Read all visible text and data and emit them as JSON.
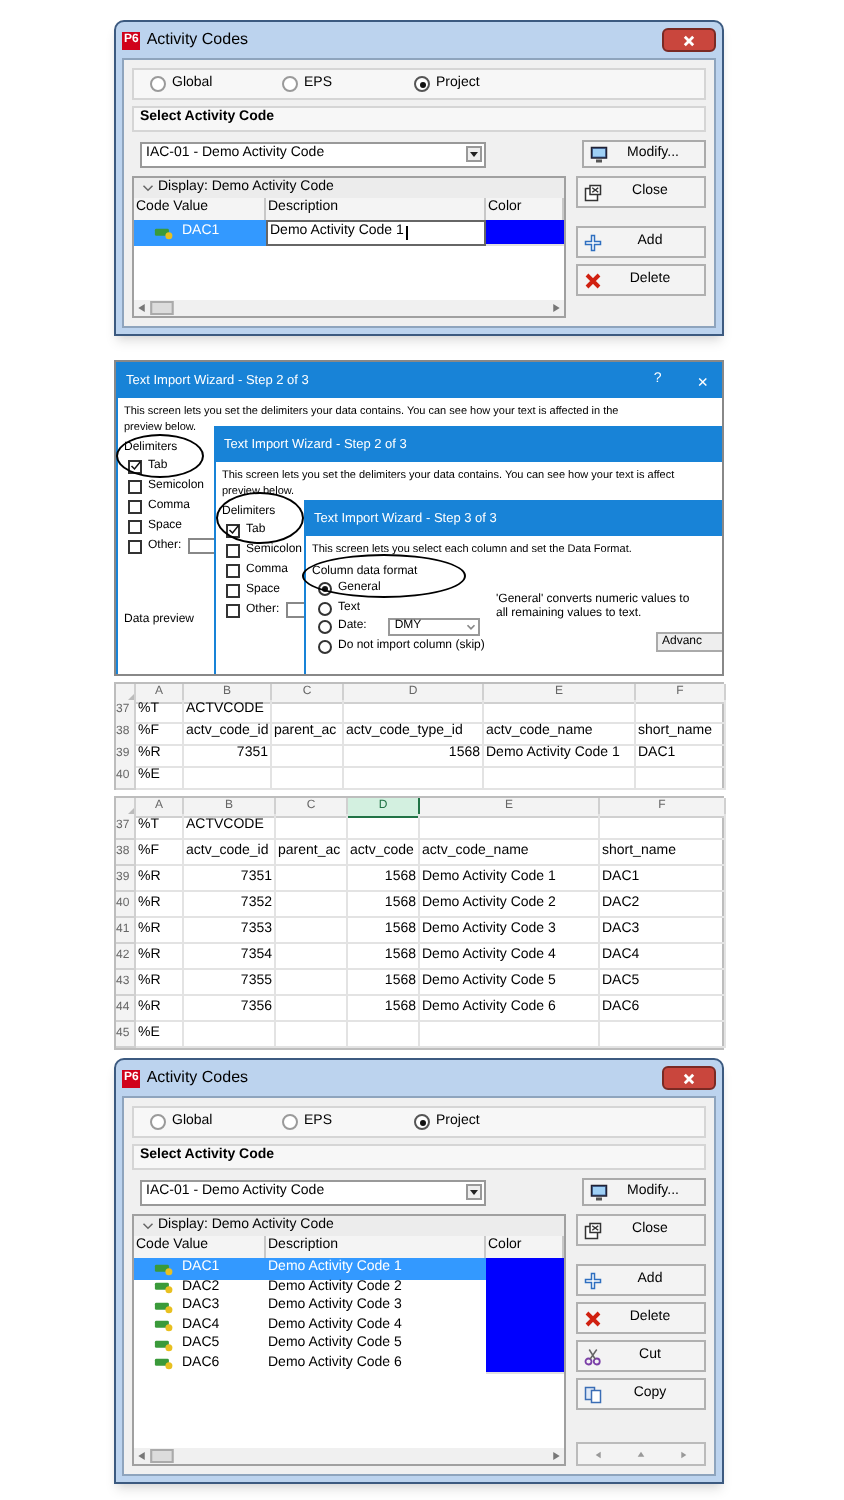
{
  "dialogs": [
    {
      "badge": "P6",
      "title": "Activity Codes",
      "scopes": [
        {
          "label": "Global",
          "selected": false
        },
        {
          "label": "EPS",
          "selected": false
        },
        {
          "label": "Project",
          "selected": true
        }
      ],
      "section": "Select Activity Code",
      "activity_code": "IAC-01 - Demo Activity Code",
      "modify": "Modify...",
      "display": "Display: Demo Activity Code",
      "columns": [
        "Code Value",
        "Description",
        "Color"
      ],
      "rows": [
        {
          "code": "DAC1",
          "description": "Demo Activity Code 1",
          "color": "#0000ff",
          "selected": true,
          "editing": true
        }
      ],
      "buttons": [
        {
          "kind": "close",
          "label": "Close"
        },
        {
          "kind": "add",
          "label": "Add"
        },
        {
          "kind": "delete",
          "label": "Delete"
        }
      ]
    },
    {
      "badge": "P6",
      "title": "Activity Codes",
      "scopes": [
        {
          "label": "Global",
          "selected": false
        },
        {
          "label": "EPS",
          "selected": false
        },
        {
          "label": "Project",
          "selected": true
        }
      ],
      "section": "Select Activity Code",
      "activity_code": "IAC-01 - Demo Activity Code",
      "modify": "Modify...",
      "display": "Display: Demo Activity Code",
      "columns": [
        "Code Value",
        "Description",
        "Color"
      ],
      "rows": [
        {
          "code": "DAC1",
          "description": "Demo Activity Code 1",
          "color": "#0000ff",
          "selected": true,
          "editing": false
        },
        {
          "code": "DAC2",
          "description": "Demo Activity Code 2",
          "color": "#0000ff",
          "selected": false,
          "editing": false
        },
        {
          "code": "DAC3",
          "description": "Demo Activity Code 3",
          "color": "#0000ff",
          "selected": false,
          "editing": false
        },
        {
          "code": "DAC4",
          "description": "Demo Activity Code 4",
          "color": "#0000ff",
          "selected": false,
          "editing": false
        },
        {
          "code": "DAC5",
          "description": "Demo Activity Code 5",
          "color": "#0000ff",
          "selected": false,
          "editing": false
        },
        {
          "code": "DAC6",
          "description": "Demo Activity Code 6",
          "color": "#0000ff",
          "selected": false,
          "editing": false
        }
      ],
      "buttons": [
        {
          "kind": "close",
          "label": "Close"
        },
        {
          "kind": "add",
          "label": "Add"
        },
        {
          "kind": "delete",
          "label": "Delete"
        },
        {
          "kind": "cut",
          "label": "Cut"
        },
        {
          "kind": "copy",
          "label": "Copy"
        }
      ],
      "navigation": true
    }
  ],
  "import_wizards": [
    {
      "kind": "delimiters",
      "title": "Text Import Wizard - Step 2 of 3",
      "help": "?",
      "close": "×",
      "description_lines": [
        "This screen lets you set the delimiters your data contains.  You can see how your text is affected in the",
        "preview below."
      ],
      "delimiters_label": "Delimiters",
      "delimiters": [
        {
          "kind": "option",
          "label": "Tab",
          "checked": true
        },
        {
          "kind": "option",
          "label": "Semicolon",
          "checked": false
        },
        {
          "kind": "option",
          "label": "Comma",
          "checked": false
        },
        {
          "kind": "option",
          "label": "Space",
          "checked": false
        },
        {
          "kind": "option_with_field",
          "label": "Other:",
          "checked": false
        }
      ],
      "data_preview": "Data preview"
    },
    {
      "kind": "delimiters",
      "title": "Text Import Wizard - Step 2 of 3",
      "description_lines": [
        "This screen lets you set the delimiters your data contains.  You can see how your text is affect",
        "preview below."
      ],
      "delimiters_label": "Delimiters",
      "delimiters": [
        {
          "kind": "option",
          "label": "Tab",
          "checked": true
        },
        {
          "kind": "option",
          "label": "Semicolon",
          "checked": false
        },
        {
          "kind": "option",
          "label": "Comma",
          "checked": false
        },
        {
          "kind": "option",
          "label": "Space",
          "checked": false
        },
        {
          "kind": "option_with_field",
          "label": "Other:",
          "checked": false
        }
      ]
    },
    {
      "kind": "format",
      "title": "Text Import Wizard - Step 3 of 3",
      "description_lines": [
        "This screen lets you select each column and set the Data Format."
      ],
      "format_label": "Column data format",
      "formats": [
        {
          "kind": "radio",
          "label": "General",
          "selected": true
        },
        {
          "kind": "radio",
          "label": "Text",
          "selected": false
        },
        {
          "kind": "radio_with_dropdown",
          "label": "Date:",
          "value": "DMY",
          "selected": false
        },
        {
          "kind": "radio",
          "label": "Do not import column (skip)",
          "selected": false
        }
      ],
      "note_lines": [
        "'General' converts numeric values to",
        "all remaining values to text."
      ],
      "advanced": "Advanc"
    }
  ],
  "sheets": [
    {
      "columns": [
        {
          "label": "A",
          "selected": false
        },
        {
          "label": "B",
          "selected": false
        },
        {
          "label": "C",
          "selected": false
        },
        {
          "label": "D",
          "selected": false
        },
        {
          "label": "E",
          "selected": false
        },
        {
          "label": "F",
          "selected": false
        }
      ],
      "rows": [
        {
          "number": "37",
          "cells": [
            "%T",
            "ACTVCODE",
            null,
            null,
            null,
            null
          ]
        },
        {
          "number": "38",
          "cells": [
            "%F",
            "actv_code_id",
            "parent_ac",
            "actv_code_type_id",
            "actv_code_name",
            "short_name"
          ]
        },
        {
          "number": "39",
          "cells": [
            "%R",
            "7351",
            null,
            "1568",
            "Demo Activity Code 1",
            "DAC1"
          ]
        },
        {
          "number": "40",
          "cells": [
            "%E",
            null,
            null,
            null,
            null,
            null
          ]
        }
      ]
    },
    {
      "columns": [
        {
          "label": "A",
          "selected": false
        },
        {
          "label": "B",
          "selected": false
        },
        {
          "label": "C",
          "selected": false
        },
        {
          "label": "D",
          "selected": true
        },
        {
          "label": "E",
          "selected": false
        },
        {
          "label": "F",
          "selected": false
        }
      ],
      "rows": [
        {
          "number": "37",
          "cells": [
            "%T",
            "ACTVCODE",
            null,
            null,
            null,
            null
          ]
        },
        {
          "number": "38",
          "cells": [
            "%F",
            "actv_code_id",
            "parent_ac",
            "actv_code",
            "actv_code_name",
            "short_name"
          ]
        },
        {
          "number": "39",
          "cells": [
            "%R",
            "7351",
            null,
            "1568",
            "Demo Activity Code 1",
            "DAC1"
          ]
        },
        {
          "number": "40",
          "cells": [
            "%R",
            "7352",
            null,
            "1568",
            "Demo Activity Code 2",
            "DAC2"
          ]
        },
        {
          "number": "41",
          "cells": [
            "%R",
            "7353",
            null,
            "1568",
            "Demo Activity Code 3",
            "DAC3"
          ]
        },
        {
          "number": "42",
          "cells": [
            "%R",
            "7354",
            null,
            "1568",
            "Demo Activity Code 4",
            "DAC4"
          ]
        },
        {
          "number": "43",
          "cells": [
            "%R",
            "7355",
            null,
            "1568",
            "Demo Activity Code 5",
            "DAC5"
          ]
        },
        {
          "number": "44",
          "cells": [
            "%R",
            "7356",
            null,
            "1568",
            "Demo Activity Code 6",
            "DAC6"
          ]
        },
        {
          "number": "45",
          "cells": [
            "%E",
            null,
            null,
            null,
            null,
            null
          ]
        }
      ]
    }
  ]
}
